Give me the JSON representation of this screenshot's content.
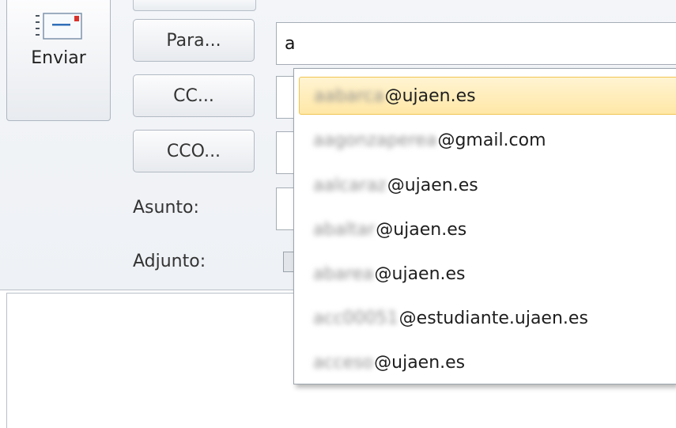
{
  "toolbar": {
    "send_label": "Enviar",
    "send_icon": "envelope-send-icon"
  },
  "fields": {
    "to_button": "Para...",
    "cc_button": "CC...",
    "bcc_button": "CCO...",
    "subject_label": "Asunto:",
    "attachment_label": "Adjunto:",
    "to_value": "a",
    "cc_value": "",
    "bcc_value": "",
    "subject_value": ""
  },
  "body": {
    "text": ""
  },
  "autocomplete": {
    "items": [
      {
        "local": "aabarca",
        "domain": "@ujaen.es",
        "selected": true
      },
      {
        "local": "aagonzaperea",
        "domain": "@gmail.com",
        "selected": false
      },
      {
        "local": "aalcaraz",
        "domain": "@ujaen.es",
        "selected": false
      },
      {
        "local": "abaltar",
        "domain": "@ujaen.es",
        "selected": false
      },
      {
        "local": "abarea",
        "domain": "@ujaen.es",
        "selected": false
      },
      {
        "local": "acc00051",
        "domain": "@estudiante.ujaen.es",
        "selected": false
      },
      {
        "local": "acceso",
        "domain": "@ujaen.es",
        "selected": false
      }
    ]
  },
  "colors": {
    "selection_fill": "#ffe7a6",
    "selection_border": "#f0c552",
    "envelope_red": "#d9322b",
    "envelope_blue": "#2f6fb8"
  }
}
